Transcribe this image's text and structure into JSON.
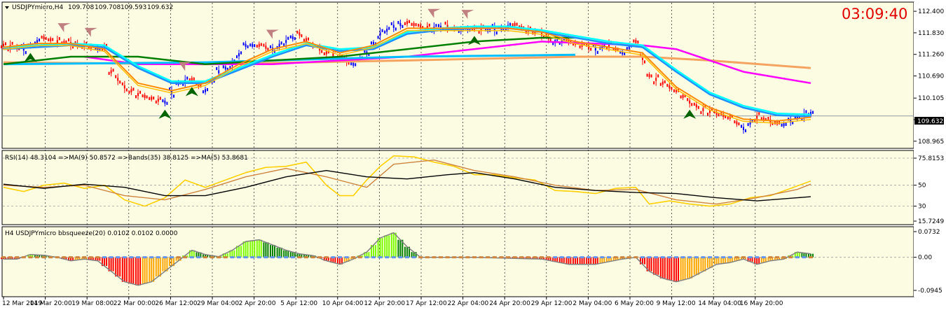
{
  "chart_data": [
    {
      "type": "line",
      "panel": "price",
      "title": "USDJPYmicro,H4",
      "ohlc_header": [
        "109.708",
        "109.708",
        "109.593",
        "109.632"
      ],
      "clock": "03:09:40",
      "current_price_label": "109.632",
      "current_price": 109.632,
      "ylim": [
        108.85,
        112.55
      ],
      "y_ticks": [
        "112.400",
        "111.830",
        "111.260",
        "110.690",
        "110.105",
        "109.535",
        "108.965"
      ],
      "x_ticks": [
        "12 Mar 2019",
        "14 Mar 20:00",
        "19 Mar 08:00",
        "22 Mar 00:00",
        "26 Mar 12:00",
        "29 Mar 04:00",
        "2 Apr 20:00",
        "5 Apr 12:00",
        "10 Apr 04:00",
        "12 Apr 20:00",
        "17 Apr 12:00",
        "22 Apr 04:00",
        "24 Apr 20:00",
        "29 Apr 12:00",
        "2 May 04:00",
        "6 May 20:00",
        "9 May 12:00",
        "14 May 04:00",
        "16 May 20:00"
      ],
      "close_path": [
        [
          0,
          111.5
        ],
        [
          3,
          111.4
        ],
        [
          6,
          111.7
        ],
        [
          8,
          111.6
        ],
        [
          10,
          111.55
        ],
        [
          12,
          111.5
        ],
        [
          14,
          111.4
        ],
        [
          15,
          111.45
        ],
        [
          16,
          110.8
        ],
        [
          18,
          110.4
        ],
        [
          20,
          110.2
        ],
        [
          22,
          110.1
        ],
        [
          24,
          110.0
        ],
        [
          26,
          110.5
        ],
        [
          28,
          110.6
        ],
        [
          30,
          110.3
        ],
        [
          32,
          110.8
        ],
        [
          34,
          111.0
        ],
        [
          36,
          111.5
        ],
        [
          38,
          111.5
        ],
        [
          40,
          111.4
        ],
        [
          42,
          111.6
        ],
        [
          44,
          111.8
        ],
        [
          46,
          111.5
        ],
        [
          48,
          111.3
        ],
        [
          50,
          111.2
        ],
        [
          52,
          111.0
        ],
        [
          54,
          111.3
        ],
        [
          56,
          111.8
        ],
        [
          58,
          112.0
        ],
        [
          60,
          112.1
        ],
        [
          62,
          112.0
        ],
        [
          64,
          111.95
        ],
        [
          66,
          112.0
        ],
        [
          68,
          111.9
        ],
        [
          70,
          111.95
        ],
        [
          72,
          111.9
        ],
        [
          74,
          111.95
        ],
        [
          76,
          112.05
        ],
        [
          78,
          111.9
        ],
        [
          80,
          111.8
        ],
        [
          82,
          111.6
        ],
        [
          84,
          111.6
        ],
        [
          86,
          111.5
        ],
        [
          88,
          111.4
        ],
        [
          90,
          111.5
        ],
        [
          92,
          111.3
        ],
        [
          94,
          111.6
        ],
        [
          96,
          110.7
        ],
        [
          98,
          110.5
        ],
        [
          100,
          110.3
        ],
        [
          102,
          110.0
        ],
        [
          104,
          109.8
        ],
        [
          106,
          109.7
        ],
        [
          108,
          109.6
        ],
        [
          110,
          109.3
        ],
        [
          112,
          109.6
        ],
        [
          114,
          109.5
        ],
        [
          116,
          109.4
        ],
        [
          118,
          109.6
        ],
        [
          120,
          109.7
        ]
      ],
      "ema_fast": [
        [
          0,
          111.45
        ],
        [
          5,
          111.55
        ],
        [
          10,
          111.55
        ],
        [
          15,
          111.4
        ],
        [
          20,
          110.5
        ],
        [
          25,
          110.3
        ],
        [
          30,
          110.5
        ],
        [
          35,
          111.0
        ],
        [
          40,
          111.4
        ],
        [
          45,
          111.6
        ],
        [
          50,
          111.3
        ],
        [
          55,
          111.5
        ],
        [
          60,
          111.95
        ],
        [
          65,
          111.95
        ],
        [
          70,
          111.95
        ],
        [
          75,
          111.95
        ],
        [
          80,
          111.85
        ],
        [
          85,
          111.6
        ],
        [
          90,
          111.45
        ],
        [
          95,
          111.3
        ],
        [
          100,
          110.4
        ],
        [
          105,
          109.85
        ],
        [
          110,
          109.55
        ],
        [
          115,
          109.5
        ],
        [
          120,
          109.6
        ]
      ],
      "ema_mid": [
        [
          0,
          111.4
        ],
        [
          10,
          111.5
        ],
        [
          15,
          111.45
        ],
        [
          20,
          110.9
        ],
        [
          25,
          110.5
        ],
        [
          30,
          110.5
        ],
        [
          35,
          110.85
        ],
        [
          40,
          111.2
        ],
        [
          45,
          111.5
        ],
        [
          50,
          111.35
        ],
        [
          55,
          111.4
        ],
        [
          60,
          111.8
        ],
        [
          65,
          111.9
        ],
        [
          70,
          111.95
        ],
        [
          75,
          111.95
        ],
        [
          80,
          111.85
        ],
        [
          85,
          111.7
        ],
        [
          90,
          111.55
        ],
        [
          95,
          111.45
        ],
        [
          100,
          110.8
        ],
        [
          105,
          110.2
        ],
        [
          110,
          109.85
        ],
        [
          115,
          109.65
        ],
        [
          120,
          109.62
        ]
      ],
      "sma_long": [
        [
          0,
          111.0
        ],
        [
          10,
          111.2
        ],
        [
          20,
          111.2
        ],
        [
          30,
          111.0
        ],
        [
          40,
          111.1
        ],
        [
          50,
          111.2
        ],
        [
          60,
          111.4
        ],
        [
          70,
          111.6
        ],
        [
          80,
          111.7
        ],
        [
          85,
          111.7
        ]
      ],
      "sma_slow": [
        [
          0,
          111.0
        ],
        [
          30,
          111.05
        ],
        [
          60,
          111.2
        ],
        [
          85,
          111.25
        ]
      ],
      "sma_magenta": [
        [
          12,
          111.2
        ],
        [
          20,
          111.0
        ],
        [
          40,
          111.0
        ],
        [
          60,
          111.2
        ],
        [
          80,
          111.6
        ],
        [
          95,
          111.5
        ],
        [
          100,
          111.4
        ],
        [
          110,
          110.8
        ],
        [
          120,
          110.5
        ]
      ],
      "sma_salmon": [
        [
          0,
          111.05
        ],
        [
          30,
          111.0
        ],
        [
          60,
          111.1
        ],
        [
          85,
          111.2
        ],
        [
          95,
          111.2
        ],
        [
          105,
          111.1
        ],
        [
          120,
          110.9
        ]
      ],
      "signals": [
        {
          "i": 4,
          "dir": "up"
        },
        {
          "i": 9,
          "dir": "down"
        },
        {
          "i": 13,
          "dir": "down"
        },
        {
          "i": 24,
          "dir": "up"
        },
        {
          "i": 27,
          "dir": "down"
        },
        {
          "i": 28,
          "dir": "up"
        },
        {
          "i": 40,
          "dir": "down"
        },
        {
          "i": 64,
          "dir": "down"
        },
        {
          "i": 69,
          "dir": "down"
        },
        {
          "i": 70,
          "dir": "up"
        },
        {
          "i": 102,
          "dir": "up"
        }
      ],
      "colors": {
        "up": "#0000ff",
        "down": "#ff0000",
        "ema_fast": "#ffc000",
        "ema_fast2": "#ff8c00",
        "cyan": "#00ffff",
        "blue": "#1e90ff",
        "green": "#008000",
        "magenta": "#ff00ff",
        "salmon": "#f4a460",
        "signal_up": "#006400",
        "signal_down": "#c08080"
      }
    },
    {
      "type": "line",
      "panel": "rsi",
      "title": "RSI(14) 48.3104  =>MA(9) 50.8572  =>Bands(35) 38.8125  =>MA(5) 53.8681",
      "ylim": [
        15.7249,
        75.8153
      ],
      "y_ticks": [
        "75.8153",
        "50",
        "30",
        "15.7249"
      ],
      "series": [
        {
          "name": "RSI(14)",
          "color": "#ffd000",
          "values": [
            [
              0,
              48
            ],
            [
              3,
              44
            ],
            [
              6,
              50
            ],
            [
              9,
              52
            ],
            [
              12,
              47
            ],
            [
              15,
              50
            ],
            [
              18,
              36
            ],
            [
              21,
              30
            ],
            [
              24,
              38
            ],
            [
              27,
              55
            ],
            [
              30,
              48
            ],
            [
              33,
              55
            ],
            [
              36,
              62
            ],
            [
              39,
              67
            ],
            [
              42,
              68
            ],
            [
              45,
              72
            ],
            [
              48,
              50
            ],
            [
              50,
              40
            ],
            [
              52,
              40
            ],
            [
              54,
              55
            ],
            [
              56,
              68
            ],
            [
              58,
              78
            ],
            [
              61,
              77
            ],
            [
              64,
              72
            ],
            [
              67,
              68
            ],
            [
              70,
              60
            ],
            [
              73,
              60
            ],
            [
              76,
              57
            ],
            [
              79,
              55
            ],
            [
              82,
              45
            ],
            [
              85,
              44
            ],
            [
              88,
              42
            ],
            [
              91,
              47
            ],
            [
              94,
              48
            ],
            [
              96,
              32
            ],
            [
              99,
              35
            ],
            [
              102,
              32
            ],
            [
              105,
              30
            ],
            [
              108,
              32
            ],
            [
              111,
              38
            ],
            [
              114,
              40
            ],
            [
              117,
              47
            ],
            [
              120,
              54
            ]
          ]
        },
        {
          "name": "MA(9)",
          "color": "#cd853f",
          "values": [
            [
              0,
              50
            ],
            [
              6,
              48
            ],
            [
              12,
              50
            ],
            [
              18,
              40
            ],
            [
              24,
              36
            ],
            [
              30,
              46
            ],
            [
              36,
              58
            ],
            [
              42,
              66
            ],
            [
              48,
              58
            ],
            [
              54,
              48
            ],
            [
              58,
              70
            ],
            [
              64,
              74
            ],
            [
              70,
              64
            ],
            [
              76,
              58
            ],
            [
              82,
              50
            ],
            [
              88,
              45
            ],
            [
              94,
              46
            ],
            [
              100,
              36
            ],
            [
              106,
              32
            ],
            [
              112,
              38
            ],
            [
              118,
              46
            ],
            [
              120,
              51
            ]
          ]
        },
        {
          "name": "Bands(35)",
          "color": "#000000",
          "values": [
            [
              0,
              51
            ],
            [
              6,
              47
            ],
            [
              12,
              51
            ],
            [
              18,
              48
            ],
            [
              24,
              40
            ],
            [
              30,
              40
            ],
            [
              36,
              48
            ],
            [
              42,
              58
            ],
            [
              48,
              64
            ],
            [
              54,
              58
            ],
            [
              60,
              56
            ],
            [
              66,
              60
            ],
            [
              70,
              62
            ],
            [
              76,
              56
            ],
            [
              82,
              48
            ],
            [
              88,
              45
            ],
            [
              94,
              43
            ],
            [
              100,
              42
            ],
            [
              106,
              38
            ],
            [
              112,
              35
            ],
            [
              118,
              38
            ],
            [
              120,
              39
            ]
          ]
        }
      ]
    },
    {
      "type": "bar",
      "panel": "squeeze",
      "title": "H4 USDJPYmicro bbsqueeze(20) 0.0102 0.0102 0.0000",
      "ylim": [
        -0.0945,
        0.0732
      ],
      "y_ticks": [
        "0.0732",
        "0.00",
        "-0.0945"
      ],
      "envelope": [
        [
          0,
          -0.005
        ],
        [
          2,
          -0.005
        ],
        [
          4,
          0.008
        ],
        [
          6,
          0.006
        ],
        [
          8,
          0.0
        ],
        [
          10,
          -0.01
        ],
        [
          12,
          -0.005
        ],
        [
          14,
          -0.01
        ],
        [
          16,
          -0.04
        ],
        [
          18,
          -0.07
        ],
        [
          20,
          -0.08
        ],
        [
          22,
          -0.07
        ],
        [
          24,
          -0.04
        ],
        [
          26,
          -0.01
        ],
        [
          28,
          0.02
        ],
        [
          30,
          0.008
        ],
        [
          32,
          0.002
        ],
        [
          34,
          0.02
        ],
        [
          36,
          0.045
        ],
        [
          38,
          0.05
        ],
        [
          40,
          0.035
        ],
        [
          42,
          0.02
        ],
        [
          44,
          0.01
        ],
        [
          46,
          0.005
        ],
        [
          48,
          -0.01
        ],
        [
          50,
          -0.02
        ],
        [
          52,
          -0.005
        ],
        [
          54,
          0.015
        ],
        [
          56,
          0.055
        ],
        [
          58,
          0.07
        ],
        [
          60,
          0.03
        ],
        [
          62,
          0.0
        ],
        [
          70,
          0.0
        ],
        [
          80,
          -0.005
        ],
        [
          84,
          -0.02
        ],
        [
          88,
          -0.02
        ],
        [
          92,
          -0.005
        ],
        [
          94,
          0.0
        ],
        [
          96,
          -0.04
        ],
        [
          98,
          -0.06
        ],
        [
          100,
          -0.07
        ],
        [
          102,
          -0.06
        ],
        [
          104,
          -0.04
        ],
        [
          106,
          -0.02
        ],
        [
          108,
          -0.015
        ],
        [
          110,
          -0.005
        ],
        [
          112,
          -0.02
        ],
        [
          114,
          -0.01
        ],
        [
          116,
          -0.005
        ],
        [
          118,
          0.015
        ],
        [
          120,
          0.01
        ]
      ],
      "colors": {
        "pos_strong": "#008000",
        "pos_weak": "#7cfc00",
        "neg_strong": "#ff0000",
        "neg_weak": "#ffa500",
        "envelope": "#808080",
        "dots": "#cd853f"
      }
    }
  ]
}
